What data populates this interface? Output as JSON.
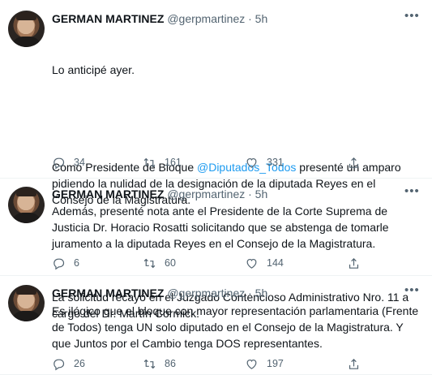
{
  "tweets": [
    {
      "author_name": "GERMAN MARTINEZ",
      "meta": "@gerpmartinez · 5h",
      "paragraphs": [
        "Lo anticipé ayer.",
        {
          "before": "Como Presidente de Bloque ",
          "mention": "@Diputados_Todos",
          "after": " presenté un amparo pidiendo la nulidad de la designación de la diputada Reyes en el Consejo de la Magistratura."
        },
        "La solicitud recayó en el Juzgado Contencioso Administrativo Nro. 11 a cargo del Dr. Martín Cormick."
      ],
      "replies": "34",
      "retweets": "161",
      "likes": "331"
    },
    {
      "author_name": "GERMAN MARTINEZ",
      "meta": "@gerpmartinez · 5h",
      "text": "Además, presenté nota ante el Presidente de la Corte Suprema de Justicia Dr. Horacio Rosatti solicitando que se abstenga de tomarle juramento a la diputada Reyes en el Consejo de la Magistratura.",
      "replies": "6",
      "retweets": "60",
      "likes": "144"
    },
    {
      "author_name": "GERMAN MARTINEZ",
      "meta": "@gerpmartinez · 5h",
      "text": "Es ilógico que el bloque con mayor representación parlamentaria (Frente de Todos) tenga UN solo diputado en el Consejo de la Magistratura. Y que Juntos por el Cambio tenga DOS representantes.",
      "replies": "26",
      "retweets": "86",
      "likes": "197"
    }
  ],
  "icons": {
    "reply": "reply-icon",
    "retweet": "retweet-icon",
    "like": "heart-icon",
    "share": "share-icon",
    "more": "more-icon"
  },
  "colors": {
    "mention": "#1d9bf0",
    "secondary_text": "#536471",
    "divider": "#eff3f4"
  }
}
